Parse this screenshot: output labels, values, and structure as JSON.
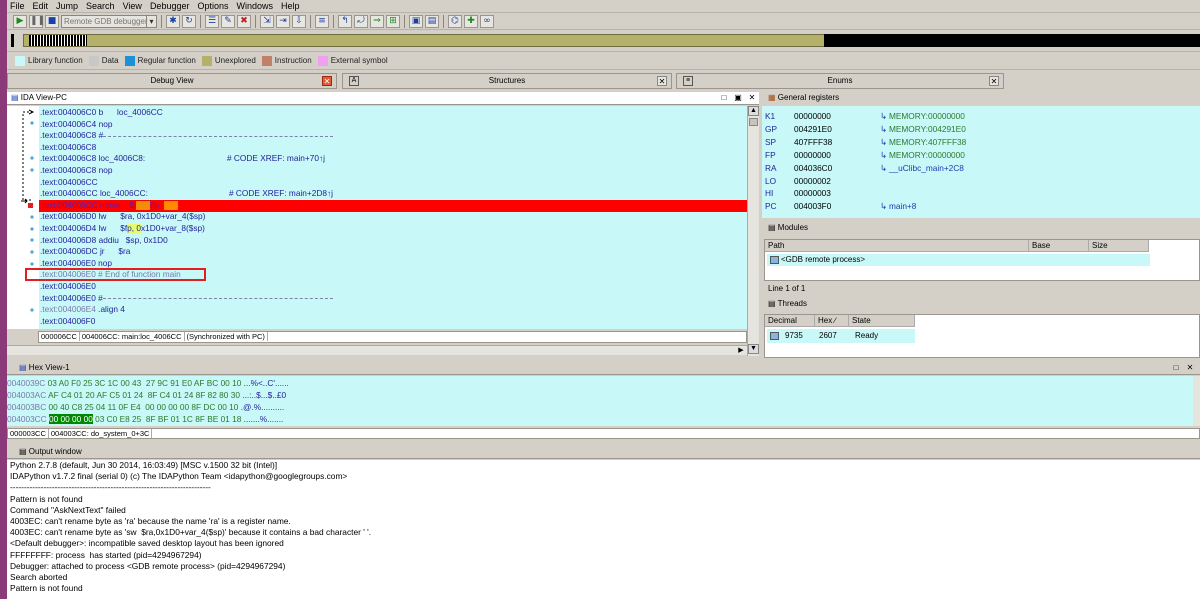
{
  "menu": [
    "File",
    "Edit",
    "Jump",
    "Search",
    "View",
    "Debugger",
    "Options",
    "Windows",
    "Help"
  ],
  "toolbar": {
    "debugger_select": "Remote GDB debugger"
  },
  "legend": [
    {
      "label": "Library function",
      "color": "#c8f8f8"
    },
    {
      "label": "Data",
      "color": "#c8c8c8"
    },
    {
      "label": "Regular function",
      "color": "#1e90d8"
    },
    {
      "label": "Unexplored",
      "color": "#b4b26a"
    },
    {
      "label": "Instruction",
      "color": "#c0806a"
    },
    {
      "label": "External symbol",
      "color": "#f0a0f0"
    }
  ],
  "tabs": [
    "Debug View",
    "Structures",
    "Enums"
  ],
  "ida_view": {
    "title": "IDA View-PC",
    "lines": [
      {
        "addr": ".text:004006C0",
        "code": " b      loc_4006CC"
      },
      {
        "addr": ".text:004006C4",
        "code": " nop"
      },
      {
        "addr": ".text:004006C8",
        "code": " #"
      },
      {
        "addr": ".text:004006C8",
        "code": ""
      },
      {
        "addr": ".text:004006C8",
        "code": " loc_4006C8:",
        "xref": "# CODE XREF: main+70↑j"
      },
      {
        "addr": ".text:004006C8",
        "code": " nop"
      },
      {
        "addr": ".text:004006CC",
        "code": ""
      },
      {
        "addr": ".text:004006CC",
        "code": " loc_4006CC:",
        "xref": "# CODE XREF: main+2D8↑j"
      },
      {
        "addr": ".text:004006CC",
        "code": " move    $sp, $fp"
      },
      {
        "addr": ".text:004006D0",
        "code": " lw      $ra, 0x1D0+var_4($sp)"
      },
      {
        "addr": ".text:004006D4",
        "code": " lw      $fp, 0x1D0+var_8($sp)"
      },
      {
        "addr": ".text:004006D8",
        "code": " addiu   $sp, 0x1D0"
      },
      {
        "addr": ".text:004006DC",
        "code": " jr      $ra"
      },
      {
        "addr": ".text:004006E0",
        "code": " nop"
      },
      {
        "addr": ".text:004006E0",
        "code": " # End of function main"
      },
      {
        "addr": ".text:004006E0",
        "code": ""
      },
      {
        "addr": ".text:004006E0",
        "code": " #"
      },
      {
        "addr": ".text:004006E4",
        "code": " .align 4"
      },
      {
        "addr": ".text:004006F0",
        "code": ""
      }
    ],
    "status": [
      "000006CC",
      "004006CC: main:loc_4006CC",
      "(Synchronized with PC)"
    ]
  },
  "registers": {
    "title": "General registers",
    "rows": [
      {
        "name": "K1",
        "value": "00000000",
        "target": "MEMORY:00000000"
      },
      {
        "name": "GP",
        "value": "004291E0",
        "target": "MEMORY:004291E0"
      },
      {
        "name": "SP",
        "value": "407FFF38",
        "target": "MEMORY:407FFF38"
      },
      {
        "name": "FP",
        "value": "00000000",
        "target": "MEMORY:00000000"
      },
      {
        "name": "RA",
        "value": "004036C0",
        "target": "__uClibc_main+2C8"
      },
      {
        "name": "LO",
        "value": "00000002",
        "target": ""
      },
      {
        "name": "HI",
        "value": "00000003",
        "target": ""
      },
      {
        "name": "PC",
        "value": "004003F0",
        "target": "main+8"
      }
    ]
  },
  "modules": {
    "title": "Modules",
    "columns": [
      "Path",
      "Base",
      "Size"
    ],
    "rows": [
      "<GDB remote process>"
    ],
    "line_info": "Line 1 of 1"
  },
  "threads": {
    "title": "Threads",
    "columns": [
      "Decimal",
      "Hex",
      "State"
    ],
    "rows": [
      {
        "decimal": "9735",
        "hex": "2607",
        "state": "Ready"
      }
    ]
  },
  "hex_view": {
    "title": "Hex View-1",
    "lines": [
      {
        "addr": "0040039C",
        "bytes": "03 A0 F0 25 3C 1C 00 43  27 9C 91 E0 AF BC 00 10",
        "ascii": " ...%<..C'......"
      },
      {
        "addr": "004003AC",
        "bytes": "AF C4 01 20 AF C5 01 24  8F C4 01 24 8F 82 80 30",
        "ascii": " ...:..$...$..£0"
      },
      {
        "addr": "004003BC",
        "bytes": "00 40 C8 25 04 11 0F E4  00 00 00 00 8F DC 00 10",
        "ascii": " .@.%.........."
      },
      {
        "addr": "004003CC",
        "selected": "00 00 00 00",
        "bytes": " 03 C0 E8 25  8F BF 01 1C 8F BE 01 18",
        "ascii": " .......%......."
      }
    ],
    "status": [
      "000003CC",
      "004003CC: do_system_0+3C"
    ]
  },
  "output": {
    "title": "Output window",
    "lines": [
      "Python 2.7.8 (default, Jun 30 2014, 16:03:49) [MSC v.1500 32 bit (Intel)]",
      "IDAPython v1.7.2 final (serial 0) (c) The IDAPython Team <idapython@googlegroups.com>",
      "------------------------------------------------------------------------",
      "Pattern is not found",
      "Command \"AskNextText\" failed",
      "4003EC: can't rename byte as 'ra' because the name 'ra' is a register name.",
      "4003EC: can't rename byte as 'sw  $ra,0x1D0+var_4($sp)' because it contains a bad character ' '.",
      "<Default debugger>: incompatible saved desktop layout has been ignored",
      "FFFFFFFF: process  has started (pid=4294967294)",
      "Debugger: attached to process <GDB remote process> (pid=4294967294)",
      "Search aborted",
      "Pattern is not found"
    ]
  }
}
